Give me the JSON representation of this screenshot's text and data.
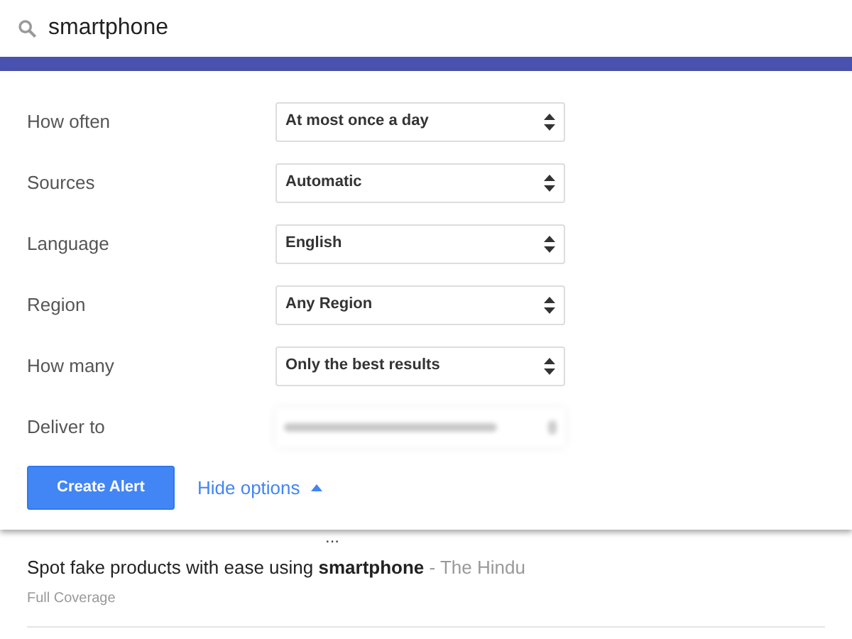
{
  "search": {
    "value": "smartphone"
  },
  "options": [
    {
      "label": "How often",
      "value": "At most once a day",
      "kind": "select"
    },
    {
      "label": "Sources",
      "value": "Automatic",
      "kind": "select"
    },
    {
      "label": "Language",
      "value": "English",
      "kind": "select"
    },
    {
      "label": "Region",
      "value": "Any Region",
      "kind": "select"
    },
    {
      "label": "How many",
      "value": "Only the best results",
      "kind": "select"
    },
    {
      "label": "Deliver to",
      "kind": "blurred"
    }
  ],
  "create_button": "Create Alert",
  "toggle_link": {
    "label": "Hide options",
    "expanded": true
  },
  "results": [
    {
      "snippet": "..."
    },
    {
      "title": "Spot fake products with ease using **smartphone**",
      "source": "- The Hindu",
      "link": "Full Coverage"
    }
  ]
}
